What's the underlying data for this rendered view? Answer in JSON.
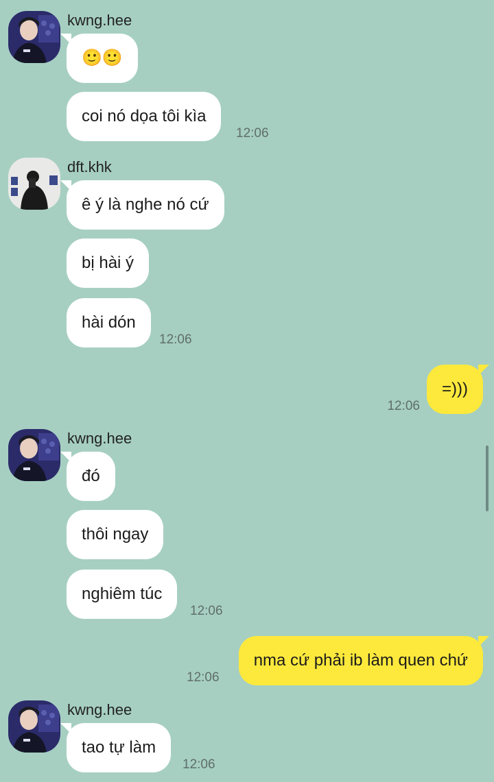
{
  "messages": [
    {
      "sender": "kwng.hee",
      "texts": [
        "🙂🙂",
        "coi nó dọa tôi kìa"
      ],
      "time": "12:06"
    },
    {
      "sender": "dft.khk",
      "texts": [
        "ê ý là nghe nó cứ",
        "bị hài ý",
        "hài dón"
      ],
      "time": "12:06"
    },
    {
      "mine": true,
      "text": "=)))",
      "time": "12:06"
    },
    {
      "sender": "kwng.hee",
      "texts": [
        "đó",
        "thôi ngay",
        "nghiêm túc"
      ],
      "time": "12:06"
    },
    {
      "mine": true,
      "text": "nma cứ phải ib làm quen chứ",
      "time": "12:06"
    },
    {
      "sender": "kwng.hee",
      "texts": [
        "tao tự làm"
      ],
      "time": "12:06"
    }
  ],
  "colors": {
    "background": "#a6cfc2",
    "incoming": "#ffffff",
    "outgoing": "#fde93c"
  }
}
